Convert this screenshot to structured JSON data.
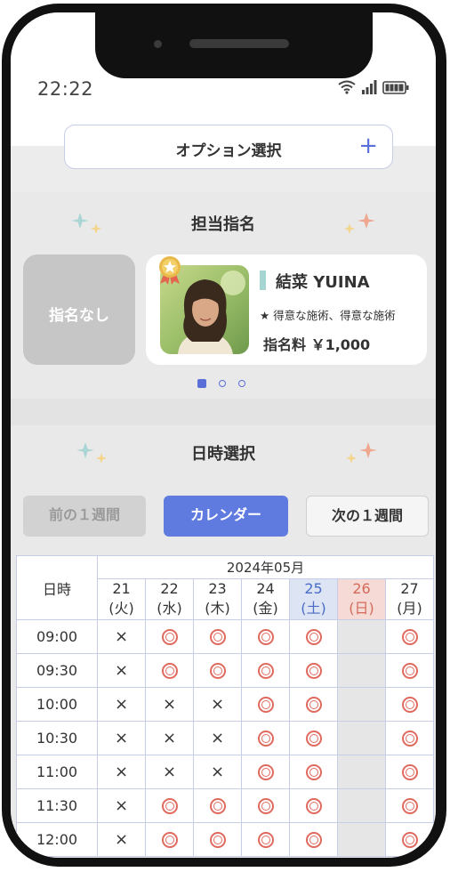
{
  "status_bar": {
    "time": "22:22",
    "icons": [
      "wifi-icon",
      "signal-icon",
      "battery-icon"
    ]
  },
  "option": {
    "label": "オプション選択",
    "plus": "+"
  },
  "staff_section": {
    "title": "担当指名",
    "no_pick_label": "指名なし",
    "card": {
      "name": "結菜 YUINA",
      "specialty": "★ 得意な施術、得意な施術",
      "fee": "指名料 ￥1,000"
    },
    "pager_dots": 3,
    "active_dot": 1
  },
  "date_section": {
    "title": "日時選択",
    "prev_week": "前の１週間",
    "calendar": "カレンダー",
    "next_week": "次の１週間"
  },
  "calendar_table": {
    "month": "2024年05月",
    "time_header": "日時",
    "days": [
      {
        "num": "21",
        "dow": "(火)",
        "kind": "weekday"
      },
      {
        "num": "22",
        "dow": "(水)",
        "kind": "weekday"
      },
      {
        "num": "23",
        "dow": "(木)",
        "kind": "weekday"
      },
      {
        "num": "24",
        "dow": "(金)",
        "kind": "weekday"
      },
      {
        "num": "25",
        "dow": "(土)",
        "kind": "sat"
      },
      {
        "num": "26",
        "dow": "(日)",
        "kind": "sun"
      },
      {
        "num": "27",
        "dow": "(月)",
        "kind": "weekday"
      }
    ],
    "rows": [
      {
        "time": "09:00",
        "slots": [
          "x",
          "o",
          "o",
          "o",
          "o",
          "-",
          "o"
        ]
      },
      {
        "time": "09:30",
        "slots": [
          "x",
          "o",
          "o",
          "o",
          "o",
          "-",
          "o"
        ]
      },
      {
        "time": "10:00",
        "slots": [
          "x",
          "x",
          "x",
          "o",
          "o",
          "-",
          "o"
        ]
      },
      {
        "time": "10:30",
        "slots": [
          "x",
          "x",
          "x",
          "o",
          "o",
          "-",
          "o"
        ]
      },
      {
        "time": "11:00",
        "slots": [
          "x",
          "x",
          "x",
          "o",
          "o",
          "-",
          "o"
        ]
      },
      {
        "time": "11:30",
        "slots": [
          "x",
          "o",
          "o",
          "o",
          "o",
          "-",
          "o"
        ]
      },
      {
        "time": "12:00",
        "slots": [
          "x",
          "o",
          "o",
          "o",
          "o",
          "-",
          "o"
        ]
      }
    ],
    "symbols": {
      "x": "×"
    }
  }
}
